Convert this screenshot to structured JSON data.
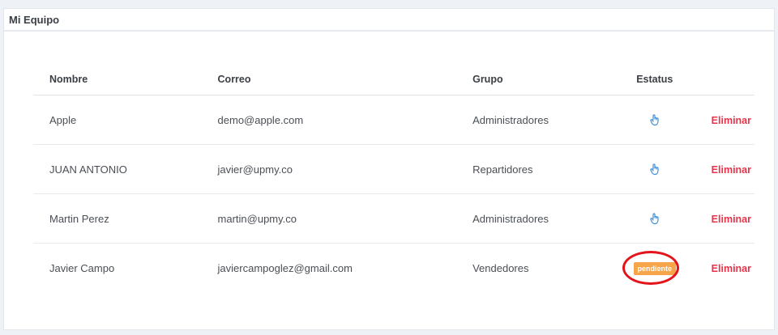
{
  "panel": {
    "title": "Mi Equipo"
  },
  "table": {
    "headers": {
      "name": "Nombre",
      "email": "Correo",
      "group": "Grupo",
      "status": "Estatus"
    },
    "rows": [
      {
        "name": "Apple",
        "email": "demo@apple.com",
        "group": "Administradores",
        "status_icon": "hand-pointer-icon",
        "action": "Eliminar"
      },
      {
        "name": "JUAN ANTONIO",
        "email": "javier@upmy.co",
        "group": "Repartidores",
        "status_icon": "hand-pointer-icon",
        "action": "Eliminar"
      },
      {
        "name": "Martin Perez",
        "email": "martin@upmy.co",
        "group": "Administradores",
        "status_icon": "hand-pointer-icon",
        "action": "Eliminar"
      },
      {
        "name": "Javier Campo",
        "email": "javiercampoglez@gmail.com",
        "group": "Vendedores",
        "status_badge": "pendiente",
        "action": "Eliminar"
      }
    ]
  },
  "colors": {
    "accent_blue": "#3b8fd9",
    "delete_red": "#e8334a",
    "badge_orange": "#f7a54a",
    "annotation_red": "#e3141b"
  }
}
